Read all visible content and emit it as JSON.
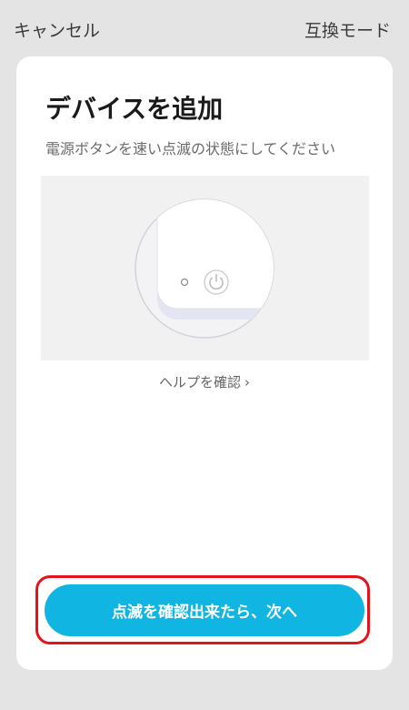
{
  "header": {
    "cancel_label": "キャンセル",
    "compat_mode_label": "互換モード"
  },
  "card": {
    "title": "デバイスを追加",
    "instruction": "電源ボタンを速い点滅の状態にしてください",
    "help_link_label": "ヘルプを確認",
    "help_chevron": "›",
    "primary_button_label": "点滅を確認出来たら、次へ"
  },
  "colors": {
    "background": "#e4e4e4",
    "card": "#ffffff",
    "accent": "#11b5e1",
    "highlight": "#e5141b"
  },
  "icons": {
    "illustration_led": "led-indicator-icon",
    "illustration_power": "power-icon",
    "help_chevron": "chevron-right-icon"
  }
}
